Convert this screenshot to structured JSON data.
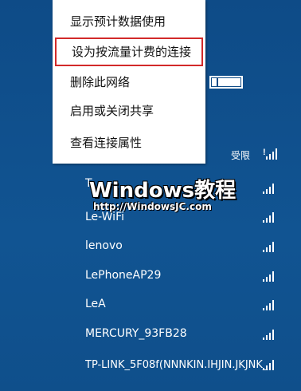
{
  "context_menu": {
    "items": [
      {
        "label": "显示预计数据使用"
      },
      {
        "label": "设为按流量计费的连接"
      },
      {
        "label": "删除此网络"
      },
      {
        "label": "启用或关闭共享"
      },
      {
        "label": "查看连接属性"
      }
    ],
    "highlighted_index": 1,
    "highlight_color": "#d22a2a"
  },
  "connected_network": {
    "status": "受限"
  },
  "networks": [
    {
      "name": "T"
    },
    {
      "name": "Le-WiFi"
    },
    {
      "name": "lenovo"
    },
    {
      "name": "LePhoneAP29"
    },
    {
      "name": "LeA"
    },
    {
      "name": "MERCURY_93FB28"
    },
    {
      "name": "TP-LINK_5F08f(NNNKIN.IHJIN.JKJNK_"
    }
  ],
  "watermark": {
    "title": "Windows教程",
    "url": "http://WindowsJC.com"
  },
  "colors": {
    "background": "#0f4f8b",
    "menu_bg": "#ffffff"
  }
}
